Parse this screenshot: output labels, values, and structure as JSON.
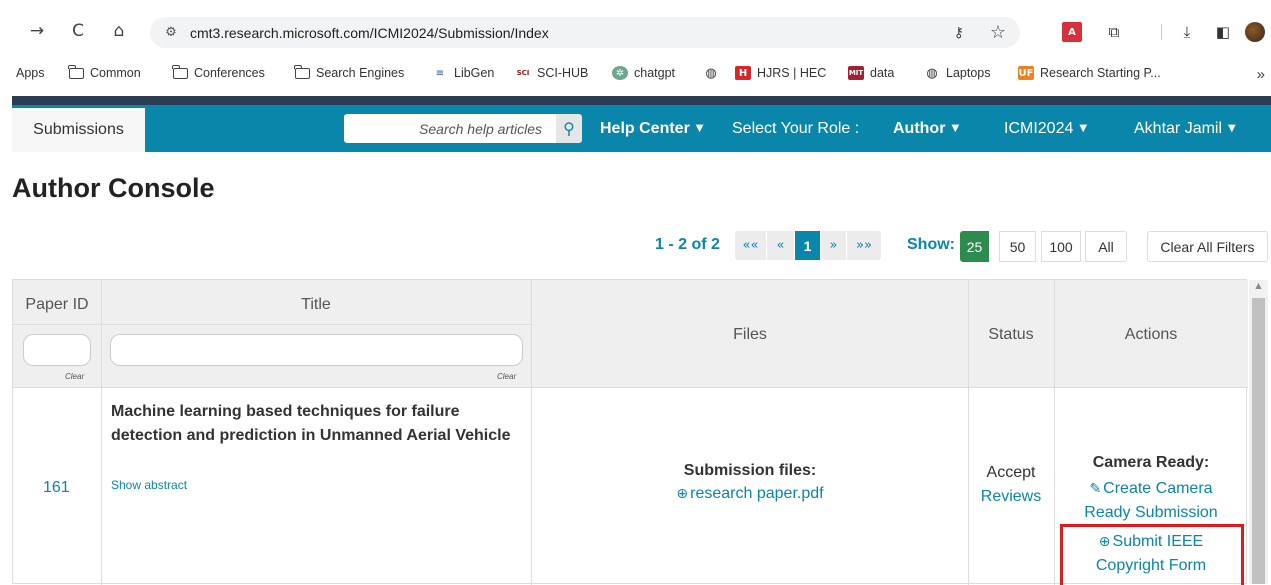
{
  "browser": {
    "url": "cmt3.research.microsoft.com/ICMI2024/Submission/Index",
    "bookmarks": [
      "Apps",
      "Common",
      "Conferences",
      "Search Engines",
      "LibGen",
      "SCI-HUB",
      "chatgpt",
      "HJRS | HEC",
      "data",
      "Laptops",
      "Research Starting P..."
    ],
    "more": "»"
  },
  "nav": {
    "tab": "Submissions",
    "search_placeholder": "Search help articles",
    "help_center": "Help Center",
    "role_label": "Select Your Role :",
    "role_value": "Author",
    "conference": "ICMI2024",
    "user": "Akhtar Jamil"
  },
  "page": {
    "title": "Author Console"
  },
  "pagination": {
    "count": "1 - 2 of 2",
    "first": "««",
    "prev": "«",
    "current": "1",
    "next": "»",
    "last": "»»",
    "show_label": "Show:",
    "sizes": [
      "25",
      "50",
      "100",
      "All"
    ],
    "active_size": "25",
    "clear_filters": "Clear All Filters"
  },
  "table": {
    "headers": {
      "id": "Paper ID",
      "title": "Title",
      "files": "Files",
      "status": "Status",
      "actions": "Actions"
    },
    "clear": "Clear",
    "rows": [
      {
        "id": "161",
        "title": "Machine learning based techniques for failure detection and prediction in Unmanned Aerial Vehicle",
        "show_abstract": "Show abstract",
        "files_heading": "Submission files:",
        "file_name": "research paper.pdf",
        "status": "Accept",
        "reviews": "Reviews",
        "actions_heading": "Camera Ready:",
        "action_create_1": "Create Camera",
        "action_create_2": "Ready Submission",
        "action_copyright_1": "Submit IEEE",
        "action_copyright_2": "Copyright Form"
      }
    ]
  }
}
